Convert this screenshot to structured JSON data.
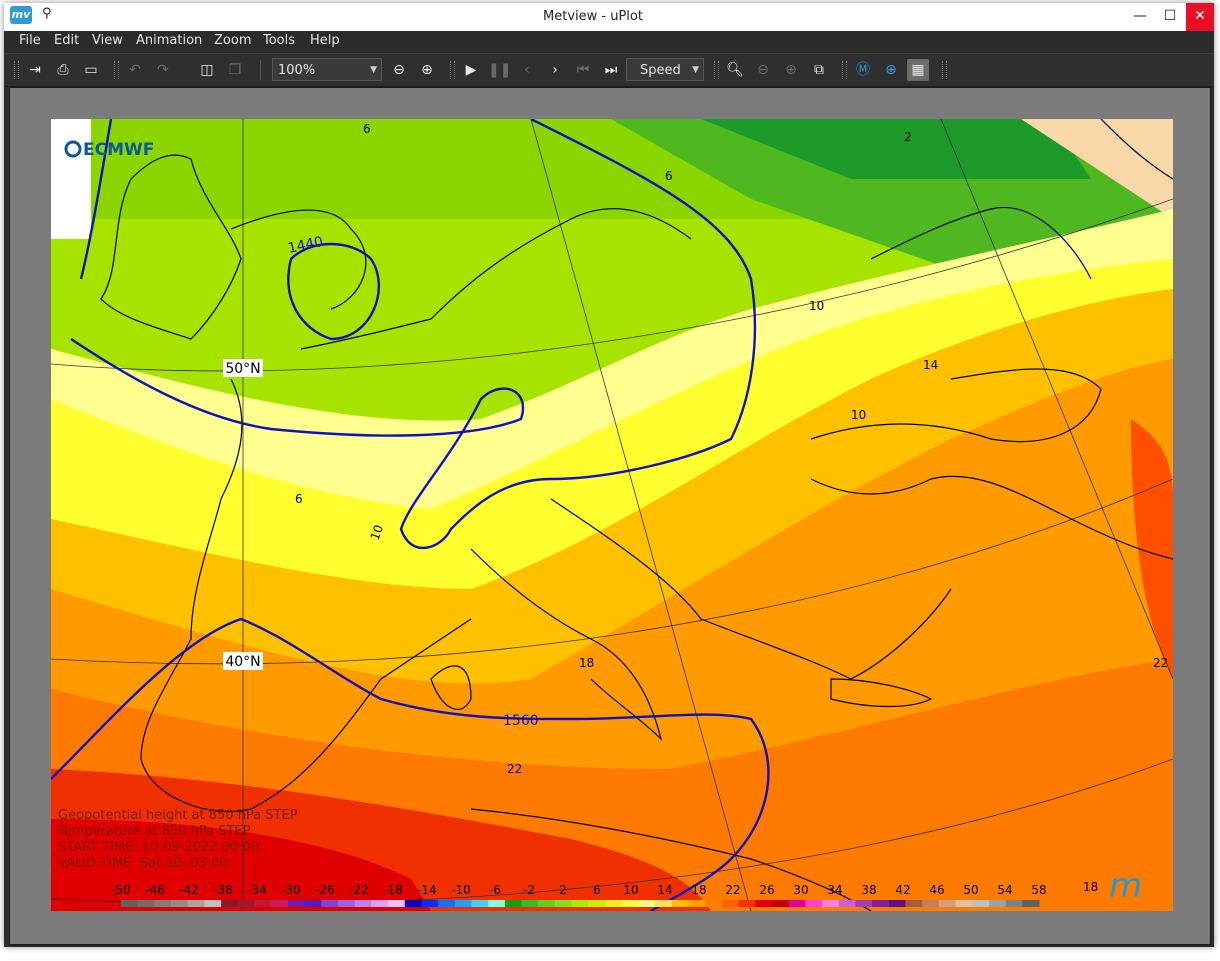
{
  "window": {
    "title": "Metview - uPlot",
    "logo_text": "mv"
  },
  "menu": [
    {
      "label": "File"
    },
    {
      "label": "Edit"
    },
    {
      "label": "View"
    },
    {
      "label": "Animation"
    },
    {
      "label": "Zoom"
    },
    {
      "label": "Tools"
    },
    {
      "label": "Help"
    }
  ],
  "toolbar": {
    "zoom_value": "100%",
    "speed_label": "Speed"
  },
  "map": {
    "brand": "ECMWF",
    "lat_labels": [
      "50°N",
      "40°N"
    ],
    "contour_labels": [
      "1440",
      "1560"
    ],
    "temp_labels": [
      "6",
      "6",
      "2",
      "6",
      "10",
      "10",
      "10",
      "14",
      "18",
      "22",
      "22",
      "18"
    ],
    "info_lines": [
      "Geopotential height at 850 hPa  STEP",
      "Temperature at 850 hPa  STEP",
      "START TIME: 10-09-2022 00:00",
      "VALID TIME:  Sat 10, 03:00"
    ],
    "legend_ticks": [
      "-50",
      "-46",
      "-42",
      "-38",
      "-34",
      "-30",
      "-26",
      "-22",
      "-18",
      "-14",
      "-10",
      "-6",
      "-2",
      "2",
      "6",
      "10",
      "14",
      "18",
      "22",
      "26",
      "30",
      "34",
      "38",
      "42",
      "46",
      "50",
      "54",
      "58"
    ],
    "legend_colors": [
      "#606060",
      "#6e6e6e",
      "#7e7e7e",
      "#8e8e8e",
      "#a6a6a6",
      "#c0c0c0",
      "#8a1a2a",
      "#a01830",
      "#c01838",
      "#d01a60",
      "#7a1aa0",
      "#5a1ac0",
      "#8a40d0",
      "#a060e0",
      "#c080f0",
      "#e0a0f8",
      "#f0c0ff",
      "#0000c0",
      "#0030ff",
      "#1070ff",
      "#20a0ff",
      "#40d0ff",
      "#80ffe0",
      "#10a010",
      "#30c020",
      "#60d020",
      "#80e020",
      "#a0f000",
      "#c8f000",
      "#e8f020",
      "#ffff40",
      "#ffff80",
      "#ffe060",
      "#ffc000",
      "#ffa000",
      "#ff8000",
      "#ff6000",
      "#ff3000",
      "#e00000",
      "#c00000",
      "#e000a0",
      "#ff40d0",
      "#ff80e0",
      "#d060d0",
      "#a040b0",
      "#80209a",
      "#601080",
      "#a06040",
      "#c08060",
      "#d0a080",
      "#e0c0a0",
      "#c0c0c0",
      "#a0a0a0",
      "#808080",
      "#606060"
    ]
  }
}
